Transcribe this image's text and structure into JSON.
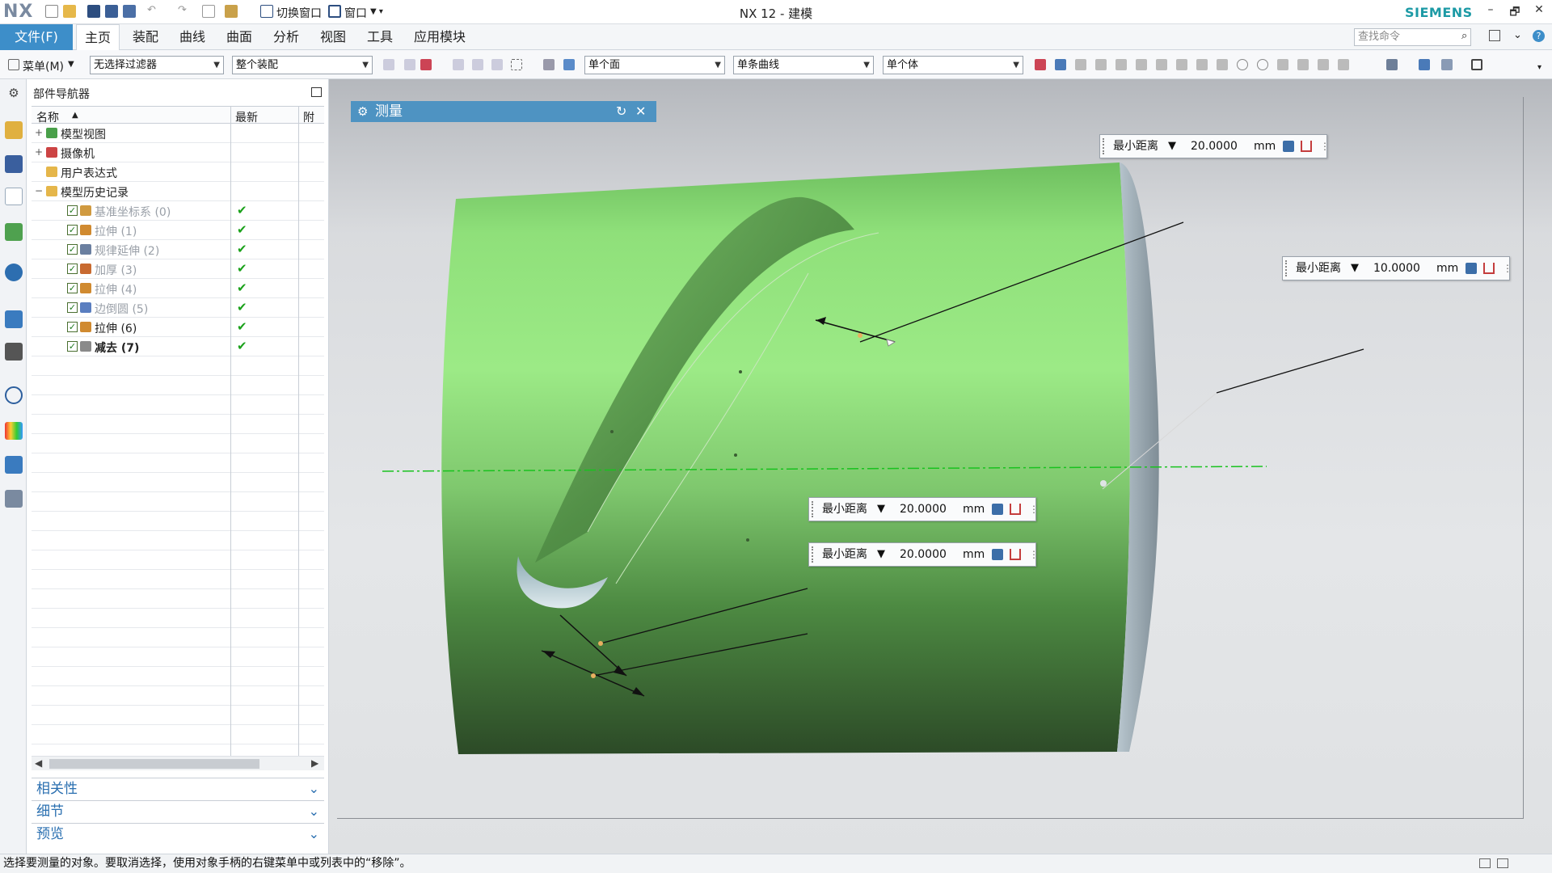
{
  "title_bar": {
    "logo": "NX",
    "title": "NX 12 - 建模",
    "brand": "SIEMENS",
    "switch_window": "切换窗口",
    "window_menu": "窗口",
    "minimize": "–",
    "restore": "🗗",
    "close": "✕"
  },
  "menu": {
    "file_tab": "文件(F)",
    "tabs": [
      "主页",
      "装配",
      "曲线",
      "曲面",
      "分析",
      "视图",
      "工具",
      "应用模块"
    ],
    "active_tab": "主页",
    "command_search_placeholder": "查找命令"
  },
  "toolbar": {
    "menu_label": "菜单(M)",
    "type_filter": "无选择过滤器",
    "scope_filter": "整个装配",
    "face_rule": "单个面",
    "curve_rule": "单条曲线",
    "body_rule": "单个体"
  },
  "navigator": {
    "title": "部件导航器",
    "columns": {
      "name": "名称",
      "latest": "最新",
      "extra": "附"
    },
    "nodes": [
      {
        "label": "模型视图",
        "expand": "+",
        "icon": "model-views-icon",
        "dim": false,
        "bold": false,
        "level": 0
      },
      {
        "label": "摄像机",
        "expand": "+",
        "icon": "camera-icon",
        "dim": false,
        "bold": false,
        "level": 0
      },
      {
        "label": "用户表达式",
        "expand": "",
        "icon": "folder-icon",
        "dim": false,
        "bold": false,
        "level": 0
      },
      {
        "label": "模型历史记录",
        "expand": "−",
        "icon": "folder-open-icon",
        "dim": false,
        "bold": false,
        "level": 0
      },
      {
        "label": "基准坐标系 (0)",
        "expand": "",
        "icon": "datum-csys-icon",
        "dim": true,
        "bold": false,
        "level": 1,
        "checked": true,
        "latest": "✔"
      },
      {
        "label": "拉伸 (1)",
        "expand": "",
        "icon": "extrude-icon",
        "dim": true,
        "bold": false,
        "level": 1,
        "checked": true,
        "latest": "✔"
      },
      {
        "label": "规律延伸 (2)",
        "expand": "",
        "icon": "law-extension-icon",
        "dim": true,
        "bold": false,
        "level": 1,
        "checked": true,
        "latest": "✔"
      },
      {
        "label": "加厚 (3)",
        "expand": "",
        "icon": "thicken-icon",
        "dim": true,
        "bold": false,
        "level": 1,
        "checked": true,
        "latest": "✔"
      },
      {
        "label": "拉伸 (4)",
        "expand": "",
        "icon": "extrude-icon",
        "dim": true,
        "bold": false,
        "level": 1,
        "checked": true,
        "latest": "✔"
      },
      {
        "label": "边倒圆 (5)",
        "expand": "",
        "icon": "edge-blend-icon",
        "dim": true,
        "bold": false,
        "level": 1,
        "checked": true,
        "latest": "✔"
      },
      {
        "label": "拉伸 (6)",
        "expand": "",
        "icon": "extrude-icon",
        "dim": false,
        "bold": false,
        "level": 1,
        "checked": true,
        "latest": "✔"
      },
      {
        "label": "减去 (7)",
        "expand": "",
        "icon": "subtract-icon",
        "dim": false,
        "bold": true,
        "level": 1,
        "checked": true,
        "latest": "✔"
      }
    ],
    "panels": [
      "相关性",
      "细节",
      "预览"
    ]
  },
  "measure_dialog": {
    "title": "测量"
  },
  "measurements": [
    {
      "type": "最小距离",
      "value": "20.0000",
      "unit": "mm"
    },
    {
      "type": "最小距离",
      "value": "10.0000",
      "unit": "mm"
    },
    {
      "type": "最小距离",
      "value": "20.0000",
      "unit": "mm"
    },
    {
      "type": "最小距离",
      "value": "20.0000",
      "unit": "mm"
    }
  ],
  "status_bar": {
    "message": "选择要测量的对象。要取消选择，使用对象手柄的右键菜单中或列表中的“移除”。"
  },
  "colors": {
    "accent": "#3d8ec9",
    "dialog_bar": "#4e93c2",
    "cylinder_light": "#9de88a",
    "cylinder_dark": "#2e4c28",
    "check_green": "#1aa11a"
  }
}
